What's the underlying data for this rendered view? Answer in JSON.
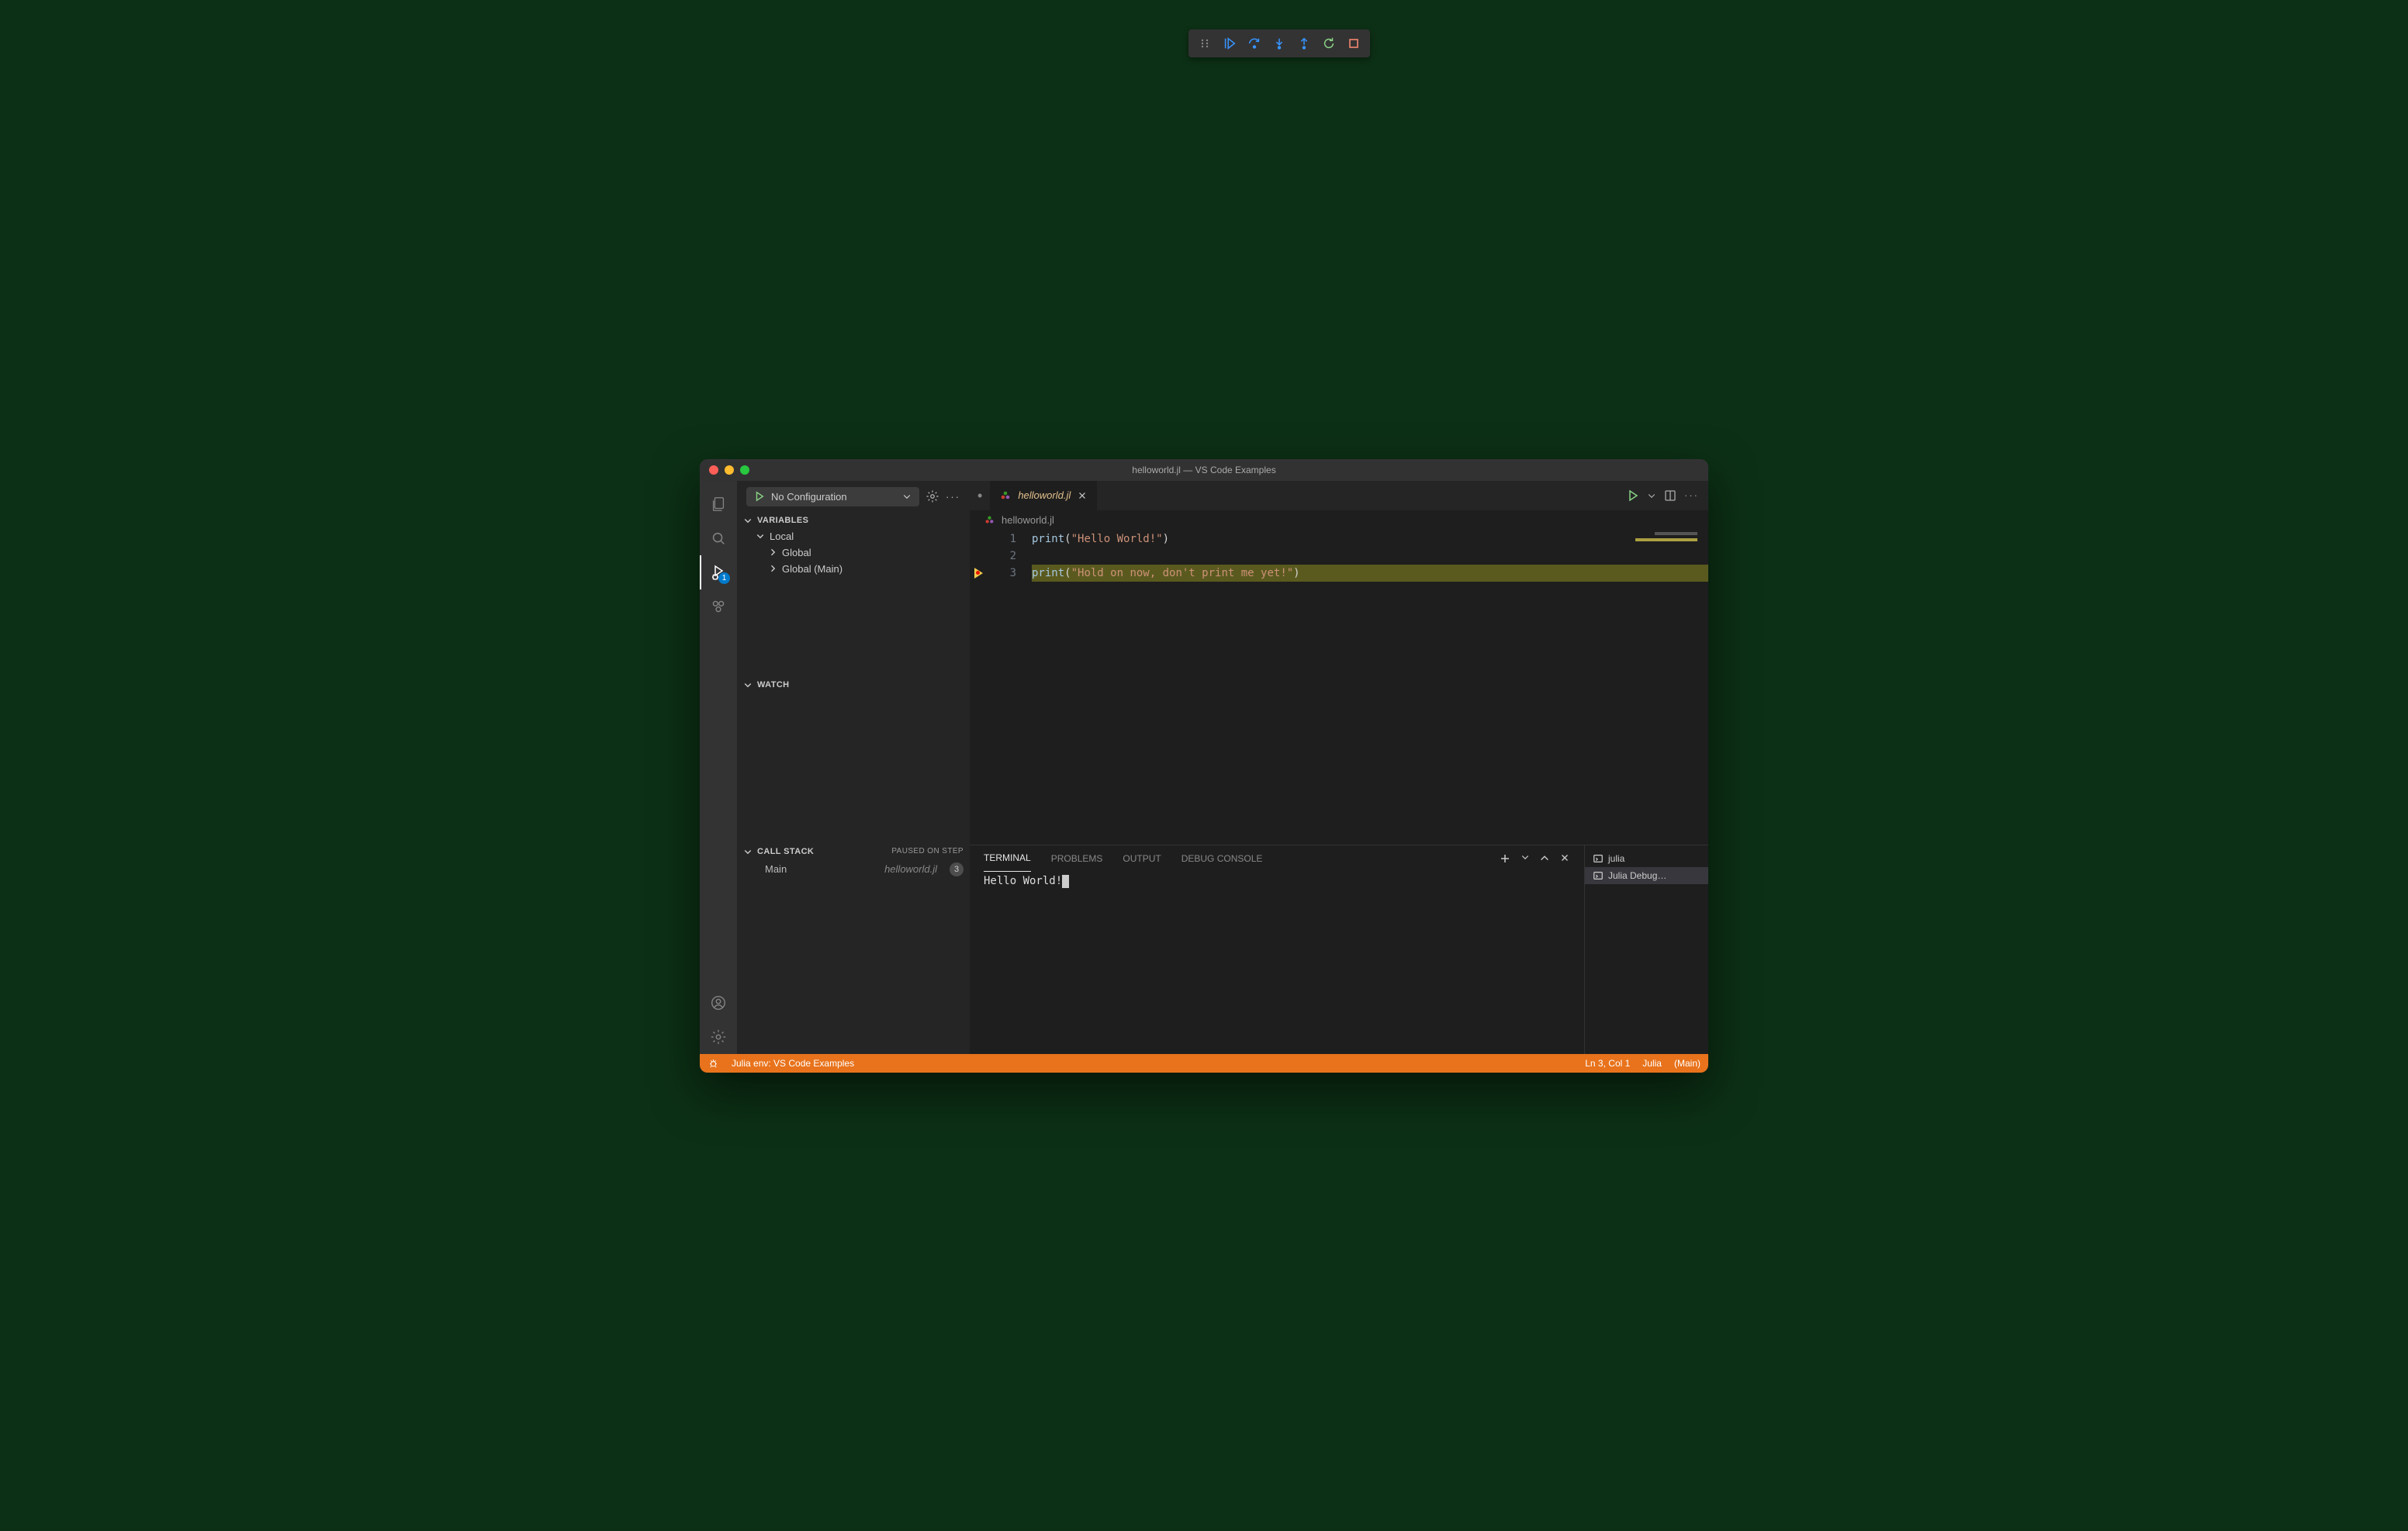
{
  "window": {
    "title": "helloworld.jl — VS Code Examples"
  },
  "activitybar": {
    "debug_badge": "1"
  },
  "debug": {
    "config_label": "No Configuration",
    "toolbar": {
      "continue": "Continue",
      "step_over": "Step Over",
      "step_into": "Step Into",
      "step_out": "Step Out",
      "restart": "Restart",
      "stop": "Stop"
    }
  },
  "sidebar": {
    "variables": {
      "title": "Variables",
      "groups": [
        "Local",
        "Global",
        "Global (Main)"
      ]
    },
    "watch": {
      "title": "Watch"
    },
    "callstack": {
      "title": "Call Stack",
      "status": "Paused on step",
      "frames": [
        {
          "name": "Main",
          "file": "helloworld.jl",
          "line": "3"
        }
      ]
    }
  },
  "tabs": [
    {
      "label": "helloworld.jl",
      "modified": true
    }
  ],
  "breadcrumb": {
    "file": "helloworld.jl"
  },
  "code": {
    "lines": [
      {
        "n": "1",
        "segments": [
          [
            "fn",
            "print"
          ],
          [
            "plain",
            "("
          ],
          [
            "str",
            "\"Hello World!\""
          ],
          [
            "plain",
            ")"
          ]
        ]
      },
      {
        "n": "2",
        "segments": []
      },
      {
        "n": "3",
        "segments": [
          [
            "fn",
            "print"
          ],
          [
            "plain",
            "("
          ],
          [
            "str",
            "\"Hold on now, don't print me yet!\""
          ],
          [
            "plain",
            ")"
          ]
        ],
        "current": true,
        "breakpoint": true
      }
    ]
  },
  "panel": {
    "tabs": [
      "TERMINAL",
      "PROBLEMS",
      "OUTPUT",
      "DEBUG CONSOLE"
    ],
    "active_tab": "TERMINAL",
    "terminal_output": "Hello World!",
    "terminal_list": [
      "julia",
      "Julia Debug…"
    ],
    "terminal_active": 1
  },
  "status": {
    "env": "Julia env: VS Code Examples",
    "position": "Ln 3, Col 1",
    "language": "Julia",
    "module": "(Main)"
  }
}
